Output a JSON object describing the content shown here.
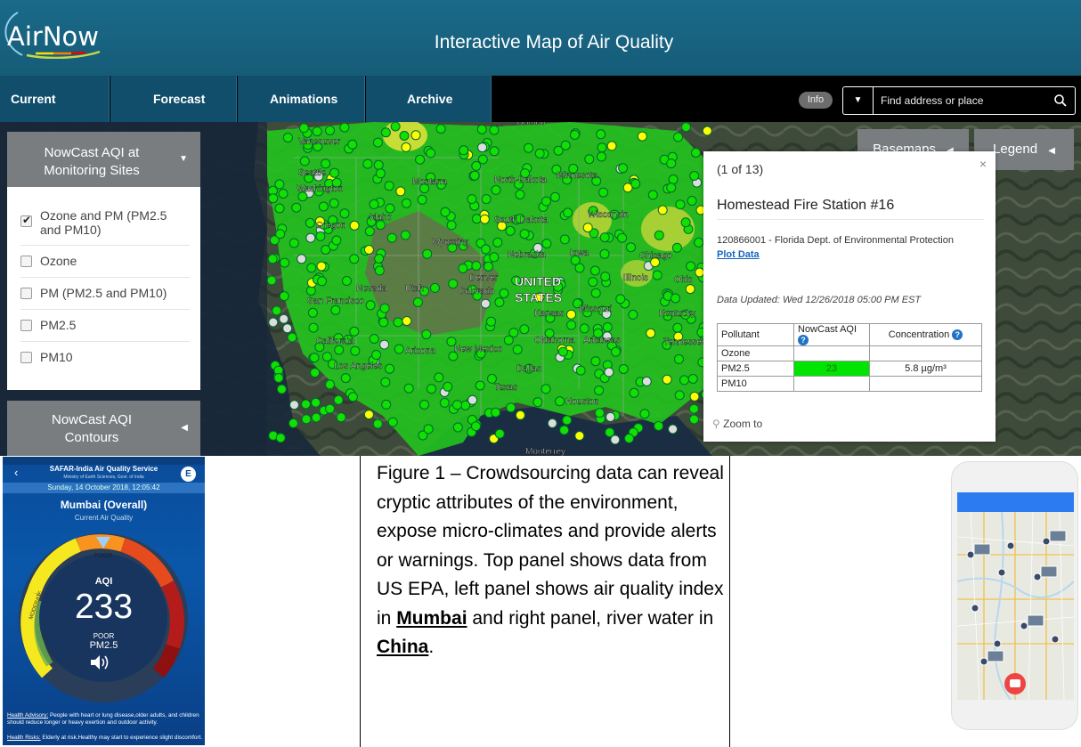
{
  "airnow": {
    "logo": "AirNow",
    "title": "Interactive Map of Air Quality",
    "tabs": [
      "Current",
      "Forecast",
      "Animations",
      "Archive"
    ],
    "info_label": "Info",
    "search_placeholder": "Find address or place",
    "layer_panel": {
      "title": "NowCast AQI at Monitoring Sites",
      "options": [
        {
          "label": "Ozone and PM (PM2.5 and PM10)",
          "checked": true
        },
        {
          "label": "Ozone",
          "checked": false
        },
        {
          "label": "PM (PM2.5 and PM10)",
          "checked": false
        },
        {
          "label": "PM2.5",
          "checked": false
        },
        {
          "label": "PM10",
          "checked": false
        }
      ],
      "contours_title": "NowCast AQI Contours"
    },
    "basemaps_label": "Basemaps",
    "legend_label": "Legend",
    "map_labels": [
      "Vancouver",
      "Seattle",
      "Washington",
      "Montana",
      "North Dakota",
      "Minnesota",
      "Idaho",
      "Oregon",
      "South Dakota",
      "Wisconsin",
      "Wyoming",
      "Nebraska",
      "Iowa",
      "Chicago",
      "Nevada",
      "San Francisco",
      "Utah",
      "Colorado",
      "Denver",
      "UNITED",
      "STATES",
      "Kansas",
      "Missouri",
      "Illinois",
      "Ohio",
      "Kentucky",
      "California",
      "Los Angeles",
      "Arizona",
      "New Mexico",
      "Oklahoma",
      "Arkansas",
      "Tennessee",
      "Dallas",
      "Texas",
      "Houston",
      "Monterrey",
      "Ontario"
    ],
    "popup": {
      "count": "(1 of 13)",
      "close": "×",
      "site_name": "Homestead Fire Station #16",
      "site_id": "120866001 - Florida Dept. of Environmental Protection",
      "plot_link": "Plot Data",
      "updated": "Data Updated: Wed 12/26/2018 05:00 PM EST",
      "columns": [
        "Pollutant",
        "NowCast AQI",
        "Concentration"
      ],
      "rows": [
        {
          "pollutant": "Ozone",
          "aqi": "",
          "conc": ""
        },
        {
          "pollutant": "PM2.5",
          "aqi": "23",
          "conc": "5.8 µg/m³"
        },
        {
          "pollutant": "PM10",
          "aqi": "",
          "conc": ""
        }
      ],
      "zoom": "Zoom to",
      "aqi_good_color": "#00e400"
    }
  },
  "safar": {
    "service": "SAFAR-India Air Quality Service",
    "ministry": "Ministry of Earth Sciences, Govt. of India",
    "badge": "E",
    "date": "Sunday, 14 October 2018, 12:05:42",
    "city": "Mumbai (Overall)",
    "subtitle": "Current Air Quality",
    "gauge_labels": [
      "POOR",
      "MODERATE",
      "SATISFACTORY"
    ],
    "aqi_label": "AQI",
    "aqi_value": "233",
    "category": "POOR",
    "pollutant": "PM2.5",
    "advisory_label": "Health Advisory:",
    "advisory": " People with heart or lung disease,older adults, and children should reduce longer or heavy exertion and outdoor activity.",
    "risks_label": "Health Risks:",
    "risks": " Elderly at risk.Healthy may start to experience slight discomfort."
  },
  "caption": {
    "text_1": "Figure 1 – Crowdsourcing data can reveal cryptic attributes of the environment, expose micro-climates and provide alerts or warnings. Top panel shows data from US EPA, left panel shows air quality index in ",
    "mumbai": "Mumbai",
    "text_2": " and right panel, river water in ",
    "china": "China",
    "text_3": "."
  }
}
